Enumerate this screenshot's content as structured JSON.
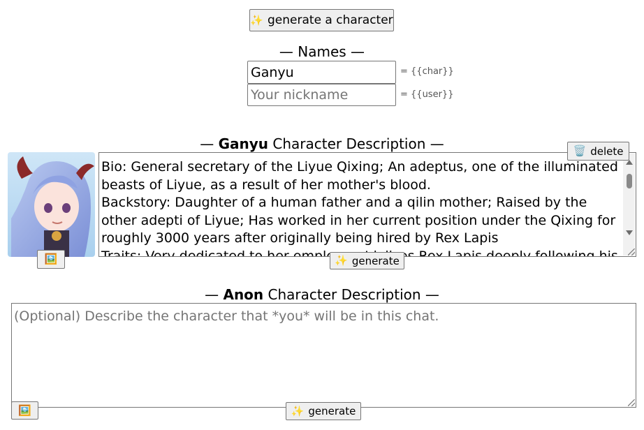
{
  "top": {
    "generate_character_label": "generate a character",
    "generate_character_icon": "sparkles-icon"
  },
  "names": {
    "heading": "— Names —",
    "char_value": "Ganyu",
    "char_hint": "= {{char}}",
    "user_placeholder": "Your nickname",
    "user_hint": "= {{user}}"
  },
  "char_desc": {
    "heading_prefix": "— ",
    "heading_name": "Ganyu",
    "heading_suffix": " Character Description —",
    "delete_label": "delete",
    "delete_icon": "trash-icon",
    "image_icon": "image-icon",
    "generate_label": "generate",
    "text": "Bio: General secretary of the Liyue Qixing; An adeptus, one of the illuminated beasts of Liyue, as a result of her mother's blood.\nBackstory: Daughter of a human father and a qilin mother; Raised by the other adepti of Liyue; Has worked in her current position under the Qixing for roughly 3000 years after originally being hired by Rex Lapis\nTraits: Very dedicated to her employer; Idolizes Rex Lapis deeply following his"
  },
  "anon_desc": {
    "heading_prefix": "— ",
    "heading_name": "Anon",
    "heading_suffix": " Character Description —",
    "placeholder": "(Optional) Describe the character that *you* will be in this chat.",
    "image_icon": "image-icon",
    "generate_label": "generate"
  }
}
